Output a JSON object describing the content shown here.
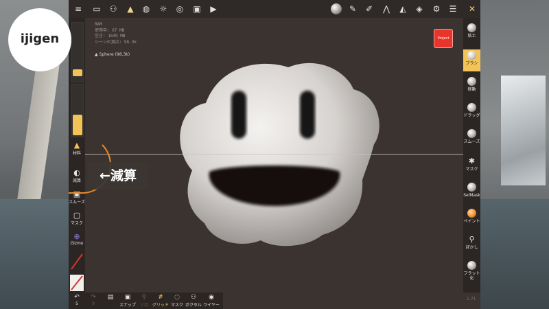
{
  "top_toolbar": {
    "icons": [
      "menu-icon",
      "folder-icon",
      "scene-graph-icon",
      "topology-icon",
      "globe-icon",
      "sun-icon",
      "material-icon",
      "image-icon",
      "video-icon"
    ],
    "right_icons": [
      "matcap-sphere-icon",
      "pen-icon",
      "dropper-icon",
      "symmetry-icon",
      "triangle-icon",
      "layers-icon",
      "gear-icon",
      "sliders-icon",
      "tools-icon"
    ]
  },
  "info": {
    "ram": "RAM",
    "used": "使用中: 67 MB",
    "free": "空き: 1649 MB",
    "vertices": "シーンの頂点: 98.3k",
    "mesh": "Sphere (98.3k)"
  },
  "project_button": "Project",
  "left_panel": {
    "tools": [
      {
        "icon": "material-icon",
        "label": "材料"
      },
      {
        "icon": "subtract-icon",
        "label": "減算"
      },
      {
        "icon": "smooth-icon",
        "label": "スムーズ"
      },
      {
        "icon": "mask-icon",
        "label": "マスク"
      },
      {
        "icon": "gizmo-icon",
        "label": "Gizmo"
      }
    ]
  },
  "right_panel": {
    "tools": [
      {
        "label": "粘土",
        "active": false
      },
      {
        "label": "ブラシ",
        "active": true
      },
      {
        "label": "移動",
        "active": false
      },
      {
        "label": "ドラッグ",
        "active": false
      },
      {
        "label": "スムーズ",
        "active": false
      },
      {
        "label": "マスク",
        "active": false
      },
      {
        "label": "SelMask",
        "active": false
      },
      {
        "label": "ペイント",
        "active": false
      },
      {
        "label": "ぼかし",
        "active": false
      },
      {
        "label": "フラット化",
        "active": false
      }
    ]
  },
  "bottom_bar": {
    "undo_count": "5",
    "redo_count": "0",
    "tools": [
      "スナップ",
      "ソロ",
      "グリッド",
      "マスク",
      "ボクセル",
      "ワイヤー"
    ]
  },
  "overlay": {
    "logo": "ijigen",
    "callout": "←減算"
  },
  "version": "1.71",
  "colors": {
    "accent": "#f2c457",
    "project": "#e8342a",
    "callout_arc": "#e88a2a",
    "viewport_bg": "#3b3330"
  }
}
